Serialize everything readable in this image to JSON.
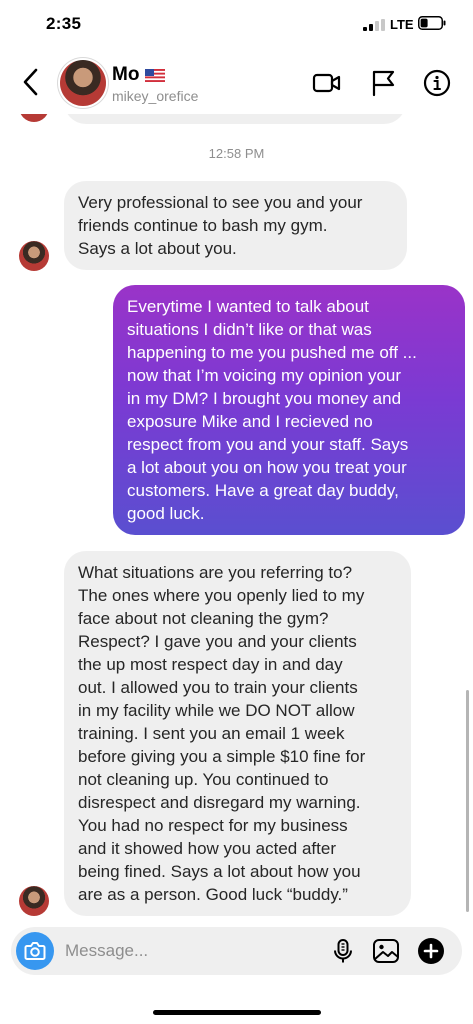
{
  "status_bar": {
    "time": "2:35",
    "network": "LTE"
  },
  "header": {
    "contact_name": "Mo",
    "contact_flag_icon": "us-flag-icon",
    "contact_handle": "mikey_orefice",
    "icons": [
      "back-chevron-icon",
      "video-call-icon",
      "flag-icon",
      "info-icon"
    ]
  },
  "conversation": {
    "timestamp": "12:58 PM",
    "messages": [
      {
        "from": "them",
        "text": "Very professional to see you and your\nfriends continue to bash my gym.\nSays a lot about you."
      },
      {
        "from": "me",
        "text": "Everytime I wanted to talk about\nsituations I didn’t like or that was\nhappening to me you pushed me off ...\nnow that I’m voicing my opinion your\nin my DM? I brought you money and\nexposure Mike and I recieved no\nrespect from you and your staff. Says\na lot about you on how you treat your\ncustomers. Have a great day buddy,\ngood luck."
      },
      {
        "from": "them",
        "text": "What situations are you referring to?\nThe ones where you openly lied to my\nface about not cleaning the gym?\nRespect? I gave you and your clients\nthe up most respect day in and day\nout. I allowed you to train your clients\nin my facility while we DO NOT allow\ntraining. I sent you an email 1 week\nbefore giving you a simple $10 fine for\nnot cleaning up. You continued to\ndisrespect and disregard my warning.\nYou had no respect for my business\nand it showed how you acted after\nbeing fined. Says a lot about how you\nare as a person. Good luck “buddy.”"
      }
    ]
  },
  "composer": {
    "placeholder": "Message...",
    "icons": [
      "camera-icon",
      "microphone-icon",
      "gallery-icon",
      "add-icon"
    ]
  },
  "colors": {
    "accent_blue": "#3797f0",
    "bubble_in": "#efefef",
    "bubble_out_top": "#9a33c8",
    "bubble_out_bottom": "#5a4fd0"
  }
}
